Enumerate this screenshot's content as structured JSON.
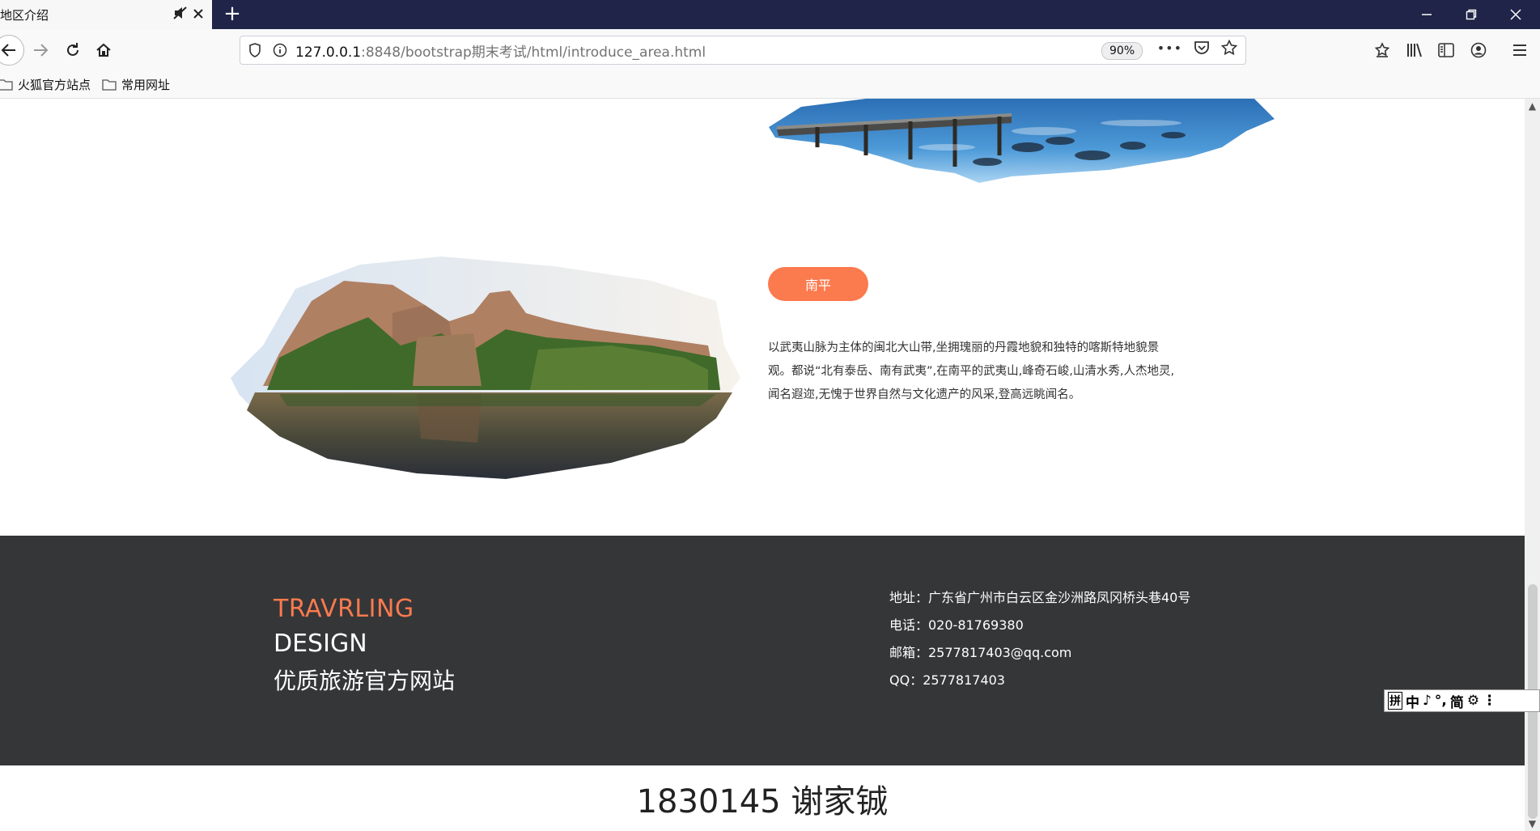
{
  "browser": {
    "tab_title": "地区介绍",
    "new_tab": "+",
    "url_host": "127.0.0.1",
    "url_rest": ":8848/bootstrap期末考试/html/introduce_area.html",
    "zoom": "90%",
    "more": "•••"
  },
  "bookmarks": [
    {
      "label": "火狐官方站点"
    },
    {
      "label": "常用网址"
    }
  ],
  "content": {
    "region_button": "南平",
    "region_description": "以武夷山脉为主体的闽北大山带,坐拥瑰丽的丹霞地貌和独特的喀斯特地貌景观。都说“北有泰岳、南有武夷”,在南平的武夷山,峰奇石峻,山清水秀,人杰地灵,闻名遐迩,无愧于世界自然与文化遗产的风采,登高远眺闻名。"
  },
  "footer": {
    "brand_line1": "TRAVRLING",
    "brand_line2": "DESIGN",
    "brand_line3": "优质旅游官方网站",
    "address": "地址：广东省广州市白云区金沙洲路凤冈桥头巷40号",
    "phone": "电话：020-81769380",
    "email": "邮箱：2577817403@qq.com",
    "qq": "QQ：2577817403"
  },
  "credit": "1830145 谢家铖",
  "ime_bar": [
    "拼",
    "中",
    "♪",
    "°,",
    "简",
    "⚙",
    "⋮"
  ],
  "colors": {
    "accent": "#fb7a4e",
    "footer_bg": "#353638",
    "tabbar_bg": "#1f2448"
  }
}
